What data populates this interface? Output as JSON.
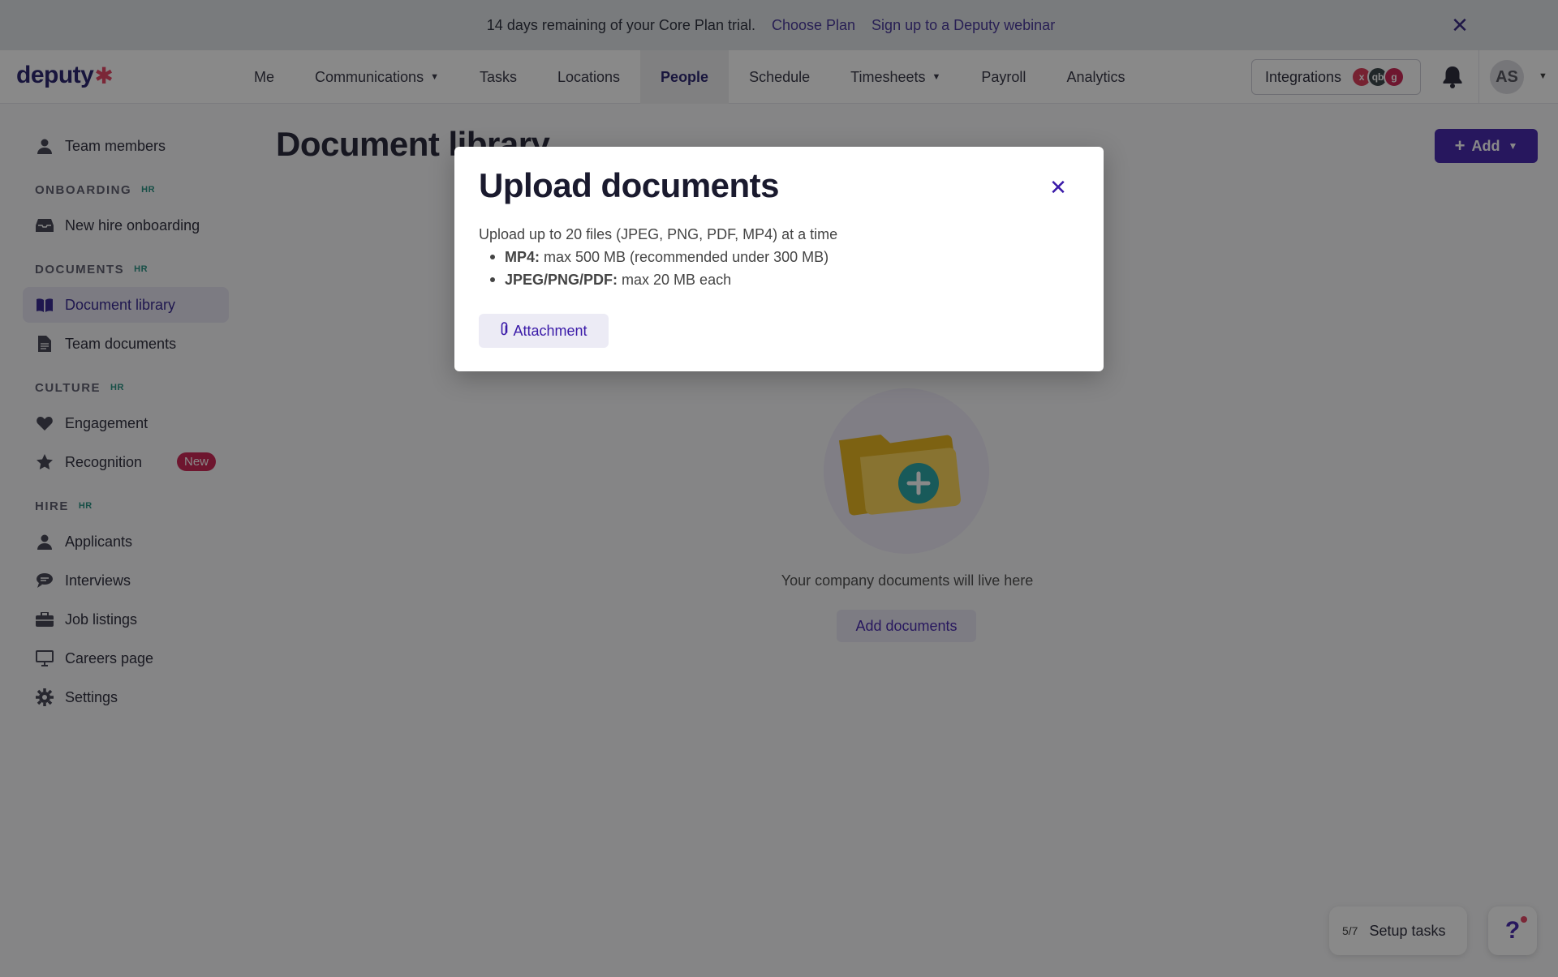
{
  "banner": {
    "message": "14 days remaining of your Core Plan trial.",
    "choose_plan": "Choose Plan",
    "webinar": "Sign up to a Deputy webinar"
  },
  "logo": {
    "text": "deputy",
    "spark": "✱"
  },
  "nav": {
    "items": [
      {
        "label": "Me"
      },
      {
        "label": "Communications",
        "dropdown": true
      },
      {
        "label": "Tasks"
      },
      {
        "label": "Locations"
      },
      {
        "label": "People",
        "active": true
      },
      {
        "label": "Schedule"
      },
      {
        "label": "Timesheets",
        "dropdown": true
      },
      {
        "label": "Payroll"
      },
      {
        "label": "Analytics"
      }
    ],
    "integrations_label": "Integrations",
    "integration_logos": [
      "xero",
      "qb",
      "g"
    ],
    "avatar_initials": "AS"
  },
  "sidebar": {
    "team_members": "Team members",
    "onboarding_section": "ONBOARDING",
    "new_hire_onboarding": "New hire onboarding",
    "documents_section": "DOCUMENTS",
    "document_library": "Document library",
    "team_documents": "Team documents",
    "culture_section": "CULTURE",
    "engagement": "Engagement",
    "recognition": "Recognition",
    "new_badge": "New",
    "hire_section": "HIRE",
    "applicants": "Applicants",
    "interviews": "Interviews",
    "job_listings": "Job listings",
    "careers_page": "Careers page",
    "settings": "Settings",
    "hr_badge": "HR"
  },
  "main": {
    "title": "Document library",
    "add_button": "Add",
    "empty_text": "Your company documents will live here",
    "add_documents_button": "Add documents"
  },
  "modal": {
    "title": "Upload documents",
    "description": "Upload up to 20 files (JPEG, PNG, PDF, MP4) at a time",
    "limits": [
      {
        "type": "MP4:",
        "text": "max 500 MB (recommended under 300 MB)"
      },
      {
        "type": "JPEG/PNG/PDF:",
        "text": "max 20 MB each"
      }
    ],
    "attachment_button": "Attachment"
  },
  "widgets": {
    "setup_count": "5/7",
    "setup_label": "Setup tasks",
    "help_glyph": "?"
  },
  "colors": {
    "brand": "#3a1aa8",
    "accent_red": "#e23a5b",
    "hr_badge": "#1a8a7a"
  }
}
